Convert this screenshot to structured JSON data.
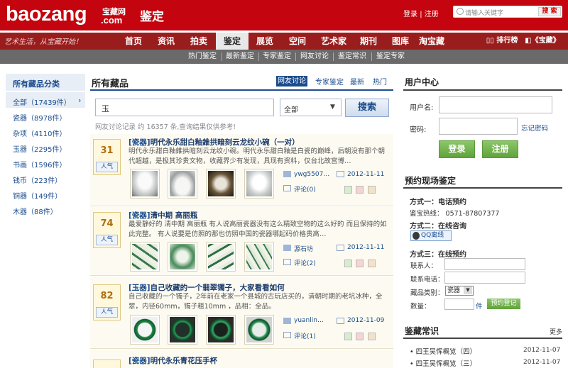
{
  "header": {
    "logo_main": "baozang",
    "logo_cn": "宝藏网",
    "logo_com": ".com",
    "section": "鉴定",
    "login": "登录",
    "register": "注册",
    "search_placeholder": "请输入关键字",
    "search_button": "搜 索",
    "colors": {
      "brand": "#c4040e",
      "nav": "#9a1d1d",
      "subnav": "#6a6a6a",
      "link": "#1a4c8c"
    }
  },
  "nav": {
    "slogan": "艺术生活，从宝藏开始！",
    "items": [
      "首页",
      "资讯",
      "拍卖",
      "鉴定",
      "展览",
      "空间",
      "艺术家",
      "期刊",
      "图库",
      "淘宝藏"
    ],
    "active": "鉴定",
    "ranking": "排行榜",
    "magazine": "《宝藏》"
  },
  "subnav": {
    "items": [
      "热门鉴定",
      "最新鉴定",
      "专家鉴定",
      "网友讨论",
      "鉴定常识",
      "鉴定专家"
    ]
  },
  "sidebar": {
    "title": "所有藏品分类",
    "items": [
      {
        "label": "全部（17439件）"
      },
      {
        "label": "瓷器（8978件）"
      },
      {
        "label": "杂项（4110件）"
      },
      {
        "label": "玉器（2295件）"
      },
      {
        "label": "书画（1596件）"
      },
      {
        "label": "钱币（223件）"
      },
      {
        "label": "铜器（149件）"
      },
      {
        "label": "木器（88件）"
      }
    ]
  },
  "main": {
    "title": "所有藏品",
    "tabs": [
      "网友讨论",
      "专家鉴定",
      "最新",
      "热门"
    ],
    "active_tab": "网友讨论",
    "keyword": "玉",
    "category_select": "全部",
    "search_button": "搜索",
    "result_info": "网友讨论记录 约 16357 条,查询结果仅供参考!",
    "popularity_label": "人气",
    "comment_label": "评论",
    "posts": [
      {
        "score": "31",
        "category": "[瓷器]",
        "title": "明代永乐甜白釉錐拱暗刻云龙纹小碗（一对）",
        "desc": "明代永乐甜白釉錐拱暗刻云龙纹小碗。明代永乐甜白釉是白瓷的巅峰，后朝没有那个朝代超越，是极其珍贵文物，收藏界少有发现，具现有资料，仅台北故宫博…",
        "user": "ywg5507…",
        "date": "2012-11-11",
        "comments": "(0)"
      },
      {
        "score": "74",
        "category": "[瓷器]",
        "title": "清中期 高丽瓶",
        "desc": "最爱静好的 清中期 高丽瓶 有人说高丽瓷器没有这么精致空物的这么好的 而且保持的如此完整。 有人说要是仿照的那也仿照中国的瓷器哪起码价格贵高…",
        "user": "源石坊",
        "date": "2012-11-11",
        "comments": "(2)"
      },
      {
        "score": "82",
        "category": "[玉器]",
        "title": "自己收藏的一个翡翠镯子，大家看看如何",
        "desc": "自己收藏的一个镯子，2年前在老家一个县城的古玩店买的，清朝时期的老坑冰种，全翠，内径60mm，镯子粗10mm ，品相：全品。",
        "user": "yuanlin…",
        "date": "2012-11-09",
        "comments": "(1)"
      },
      {
        "score": "",
        "category": "[瓷器]",
        "title": "明代永乐青花压手杯",
        "desc": "",
        "user": "",
        "date": "",
        "comments": ""
      }
    ]
  },
  "user_center": {
    "title": "用户中心",
    "username_label": "用户名:",
    "password_label": "密码:",
    "forgot": "忘记密码",
    "login_button": "登录",
    "register_button": "注册"
  },
  "booking": {
    "title": "预约现场鉴定",
    "way1": "方式一：电话预约",
    "hotline": "鉴宝热线：  0571-87807377",
    "way2": "方式二：在线咨询",
    "qq_button": "QQ离线",
    "way3": "方式三：在线预约",
    "contact_label": "联系人：",
    "phone_label": "联系电话：",
    "kind_label": "藏品类别：",
    "kind_value": "瓷器",
    "qty_label": "数量：",
    "qty_unit": "件",
    "submit": "预约登记"
  },
  "knowledge": {
    "title": "鉴藏常识",
    "more": "更多",
    "items": [
      {
        "text": "四王吴恽概览（四）",
        "date": "2012-11-07"
      },
      {
        "text": "四王吴恽概览（三）",
        "date": "2012-11-07"
      }
    ]
  }
}
